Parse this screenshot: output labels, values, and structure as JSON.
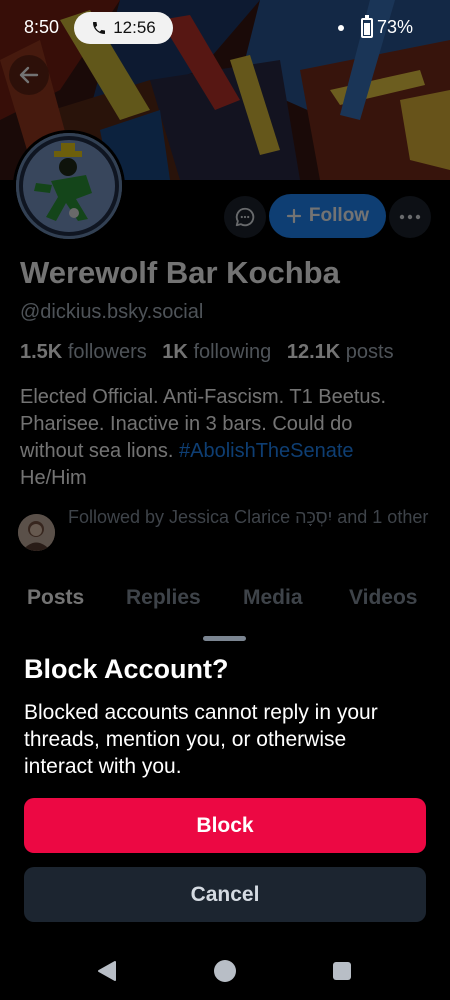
{
  "status_bar": {
    "time": "8:50",
    "call_timer": "12:56",
    "battery": "73%",
    "icons": [
      "phone-icon",
      "notification-dot-icon",
      "battery-icon"
    ]
  },
  "profile": {
    "display_name": "Werewolf Bar Kochba",
    "handle": "@dickius.bsky.social",
    "followers_count": "1.5K",
    "followers_label": "followers",
    "following_count": "1K",
    "following_label": "following",
    "posts_count": "12.1K",
    "posts_label": "posts",
    "bio_text": "Elected Official. Anti-Fascism. T1 Beetus. Pharisee. Inactive in 3 bars. Could do without sea lions.",
    "bio_hashtag": "#AbolishTheSenate",
    "bio_suffix": "He/Him",
    "followed_by": "Followed by Jessica Clarice יִסְכָּה and 1 other",
    "follow_label": "Follow"
  },
  "tabs": [
    "Posts",
    "Replies",
    "Media",
    "Videos"
  ],
  "sheet": {
    "title": "Block Account?",
    "description": "Blocked accounts cannot reply in your threads, mention you, or otherwise interact with you.",
    "block_label": "Block",
    "cancel_label": "Cancel"
  },
  "colors": {
    "accent_blue": "#208bfe",
    "danger_red": "#ec0843",
    "background": "#000000",
    "secondary_button": "#1c2530"
  }
}
